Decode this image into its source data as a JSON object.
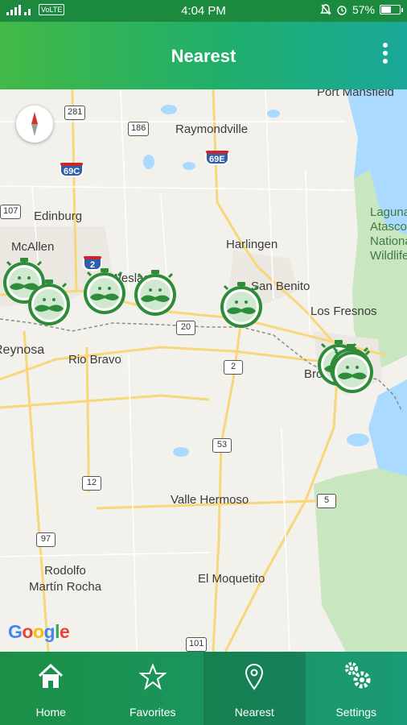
{
  "status_bar": {
    "network_label": "VoLTE",
    "time": "4:04 PM",
    "battery_percent": "57%",
    "battery_level": 0.57
  },
  "app_bar": {
    "title": "Nearest",
    "menu_icon": "more-vert-icon"
  },
  "map": {
    "places": {
      "port_mansfield": "Port Mansfield",
      "raymondville": "Raymondville",
      "edinburg": "Edinburg",
      "mcallen": "McAllen",
      "harlingen": "Harlingen",
      "weslaco": "Weslaco",
      "san_benito": "San Benito",
      "los_fresnos": "Los Fresnos",
      "reynosa": "Reynosa",
      "rio_bravo": "Rio Bravo",
      "brownsville": "Brownsville",
      "valle_hermoso": "Valle Hermoso",
      "el_moquetito": "El Moquetito",
      "rodolfo_1": "Rodolfo",
      "rodolfo_2": "Martín Rocha",
      "laguna_1": "Laguna",
      "laguna_2": "Atascosa",
      "laguna_3": "National",
      "laguna_4": "Wildlife"
    },
    "shields": {
      "r281": "281",
      "r186": "186",
      "r69c": "69C",
      "r69e": "69E",
      "r107": "107",
      "r2a": "2",
      "r20": "20",
      "r2b": "2",
      "r53": "53",
      "r12": "12",
      "r5": "5",
      "r97": "97",
      "r101": "101"
    },
    "attribution": "Google",
    "compass_icon": "compass-icon",
    "marker_icon": "mustache-stopwatch-icon",
    "marker_count": 8
  },
  "bottom_nav": {
    "items": [
      {
        "label": "Home",
        "icon": "home-icon"
      },
      {
        "label": "Favorites",
        "icon": "star-icon"
      },
      {
        "label": "Nearest",
        "icon": "location-pin-icon",
        "active": true
      },
      {
        "label": "Settings",
        "icon": "gears-icon"
      }
    ]
  },
  "colors": {
    "primary_green": "#1b8a3f",
    "marker_green": "#2e8b3a",
    "map_water": "#aadaff",
    "map_park": "#c8e6c0",
    "map_road": "#f8d67a"
  }
}
